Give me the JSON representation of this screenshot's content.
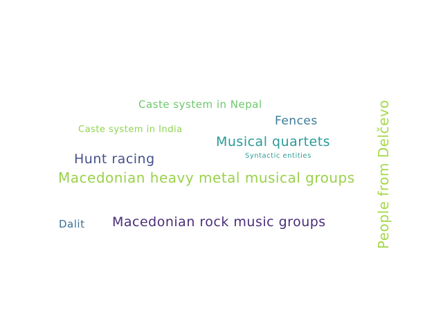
{
  "words": [
    {
      "text": "Caste system in Nepal",
      "color": "#6cc86a"
    },
    {
      "text": "Fences",
      "color": "#3a7a98"
    },
    {
      "text": "Caste system in India",
      "color": "#8fd44f"
    },
    {
      "text": "Musical quartets",
      "color": "#2a9a98"
    },
    {
      "text": "Syntactic entities",
      "color": "#2f9c94"
    },
    {
      "text": "Hunt racing",
      "color": "#46508a"
    },
    {
      "text": "Macedonian heavy metal musical groups",
      "color": "#9ad14a"
    },
    {
      "text": "Macedonian rock music groups",
      "color": "#4a2d78"
    },
    {
      "text": "Dalit",
      "color": "#3b6f95"
    },
    {
      "text": "People from Delčevo",
      "color": "#a6d94a"
    }
  ]
}
